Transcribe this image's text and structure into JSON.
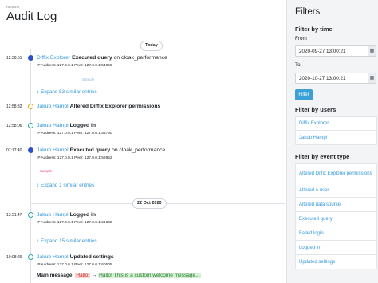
{
  "page": {
    "eyebrow": "ADMIN",
    "title": "Audit Log"
  },
  "timeline": {
    "dates": {
      "today": "Today",
      "oct22": "22 Oct 2020"
    },
    "entries": [
      {
        "time": "12:58:51",
        "user": "Diffix Explorer",
        "action": "Executed query",
        "object_prefix": "on",
        "object": "cloak_performance",
        "meta": "IP Address: 127.0.0.1 Peer: 127.0.0.1:54050",
        "tag": "Sample",
        "expand": "Expand 53 similar entries"
      },
      {
        "time": "12:58:32",
        "user": "Jakub Hampl",
        "action": "Altered Diffix Explorer permissions"
      },
      {
        "time": "12:58:06",
        "user": "Jakub Hampl",
        "action": "Logged in",
        "meta": "IP Address: 127.0.0.1 Peer: 127.0.0.1:53760"
      },
      {
        "time": "07:17:40",
        "user": "Jakub Hampl",
        "action": "Executed query",
        "object_prefix": "on",
        "object": "cloak_performance",
        "meta": "IP Address: 127.0.0.1 Peer: 127.0.0.1:58952",
        "tag": "Sample",
        "expand": "Expand 1 similar entries"
      },
      {
        "time": "13:51:47",
        "user": "Jakub Hampl",
        "action": "Logged in",
        "meta": "IP Address: 127.0.0.1 Peer: 127.0.0.1:61648",
        "expand": "Expand 15 similar entries"
      },
      {
        "time": "10:08:26",
        "user": "Jakub Hampl",
        "action": "Updated settings",
        "meta": "IP Address: 127.0.0.1 Peer: 127.0.0.1:60505",
        "message_label": "Main message:",
        "message_old": "Hallo!",
        "message_arrow": "→",
        "message_new": "Hallo! This is a custom welcome message..."
      }
    ]
  },
  "sidebar": {
    "title": "Filters",
    "time_heading": "Filter by time",
    "from_label": "From",
    "from_value": "2020-09-27 13:00:21",
    "to_label": "To",
    "to_value": "2020-10-27 13:00:21",
    "calendar_icon": "calendar-icon",
    "filter_button": "Filter",
    "users_heading": "Filter by users",
    "users": [
      "Diffix Explorer",
      "Jakub Hampl"
    ],
    "events_heading": "Filter by event type",
    "events": [
      "Altered Diffix Explorer permissions",
      "Altered a user",
      "Altered data source",
      "Executed query",
      "Failed login",
      "Logged in",
      "Updated settings"
    ]
  },
  "colors": {
    "link": "#3498db",
    "accent_button": "#3aa0d5",
    "sidebar_bg": "#f3f4f6"
  }
}
